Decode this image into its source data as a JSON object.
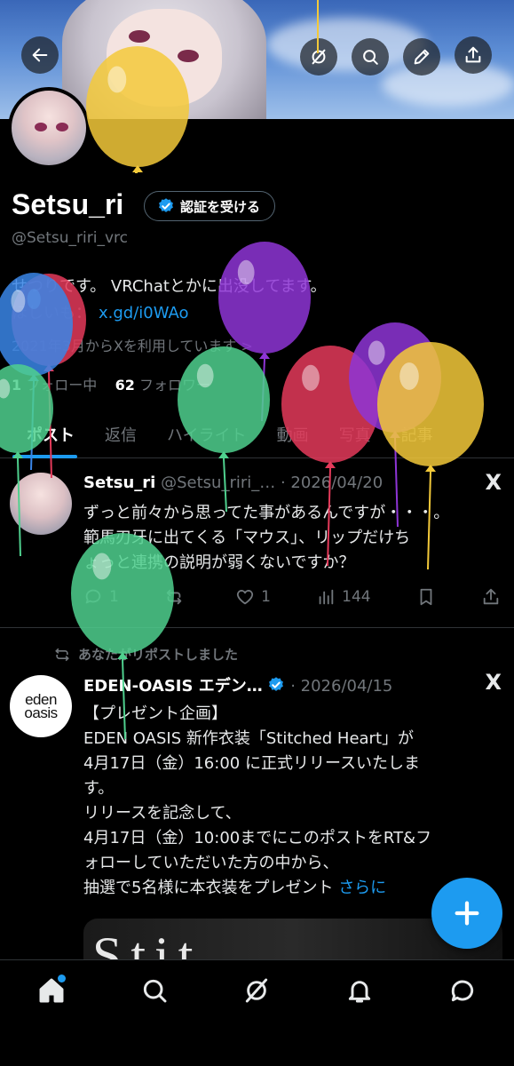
{
  "header": {
    "back_icon": "arrow-left-icon",
    "actions": [
      "grok-icon",
      "search-icon",
      "edit-icon",
      "share-icon"
    ]
  },
  "profile": {
    "display_name": "Setsu_ri",
    "verify_label": "認証を受ける",
    "handle": "@Setsu_riri_vrc",
    "bio": "せつりです。 VRChatとかに出没してます。",
    "link_prefix": "ほしいも：",
    "link": "x.gd/i0WAo",
    "joined": "2021年3月からXを利用しています >",
    "following_label": "フォロー中",
    "followers_count": "62",
    "followers_label": "フォロワー"
  },
  "tabs": [
    {
      "label": "ポスト",
      "active": true
    },
    {
      "label": "返信",
      "active": false
    },
    {
      "label": "ハイライト",
      "active": false
    },
    {
      "label": "動画",
      "active": false
    },
    {
      "label": "写真",
      "active": false
    },
    {
      "label": "記事",
      "active": false
    }
  ],
  "posts": [
    {
      "name": "Setsu_ri",
      "meta": "@Setsu_riri_… · 2026/04/20",
      "lines": [
        "ずっと前々から思ってた事があるんですが・・・。",
        "範馬刃牙に出てくる「マウス」、リップだけち",
        "ょっと連携の説明が弱くないですか？"
      ],
      "stats": {
        "replies": "1",
        "reposts": "",
        "likes": "1",
        "views": "144"
      }
    },
    {
      "repost_label": "あなたがリポストしました",
      "name": "EDEN-OASIS エデン…",
      "meta": "· 2026/04/15",
      "avatar_text": [
        "eden",
        "oasis"
      ],
      "lines": [
        "【プレゼント企画】",
        "EDEN OASIS 新作衣装「Stitched Heart」が",
        "4月17日（金）16:00 に正式リリースいたしま",
        "す。",
        "リリースを記念して、",
        "4月17日（金）10:00までにこのポストをRT&フ",
        "ォローしていただいた方の中から、",
        "抽選で5名様に本衣装をプレゼント"
      ],
      "more": "さらに",
      "media_text": "Stit"
    }
  ],
  "fab_icon": "plus-icon",
  "bottom_nav": [
    "home-icon",
    "search-icon",
    "grok-icon",
    "bell-icon",
    "message-icon"
  ],
  "colors": {
    "accent": "#1d9bf0",
    "balloon_yellow": "#f3c93a",
    "balloon_purple": "#8e35d6",
    "balloon_green": "#4fd08e",
    "balloon_red": "#e43a5a",
    "balloon_blue": "#3a86e8"
  }
}
